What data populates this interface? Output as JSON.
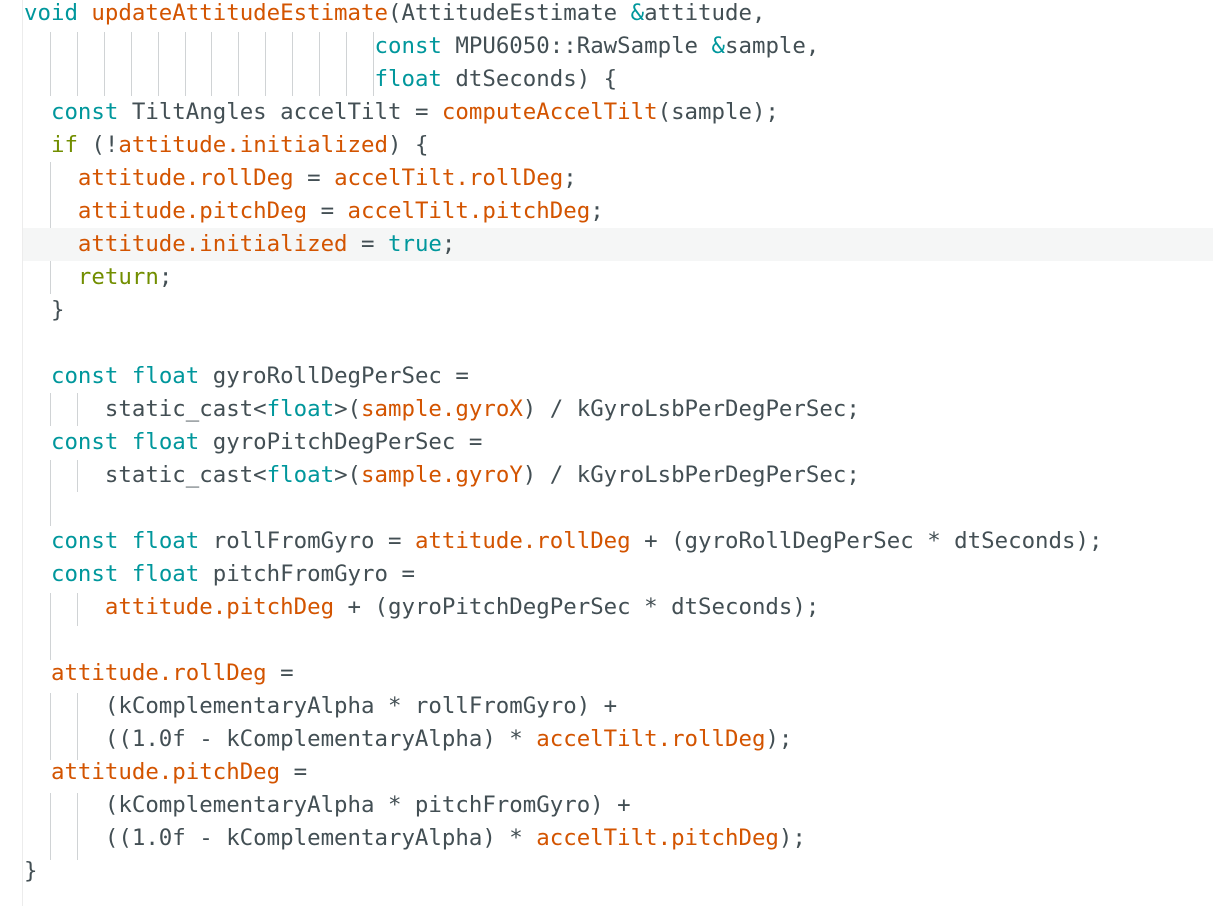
{
  "editor": {
    "language": "C++",
    "colors": {
      "background": "#ffffff",
      "current_line": "#f5f6f6",
      "keyword": "#00979c",
      "function_member": "#d35400",
      "control": "#728e00",
      "default_text": "#434f54",
      "indent_guide": "#d0d3d5"
    },
    "lines": [
      [
        [
          "kw",
          "void"
        ],
        [
          "id",
          " "
        ],
        [
          "fn",
          "updateAttitudeEstimate"
        ],
        [
          "id",
          "(AttitudeEstimate "
        ],
        [
          "kw",
          "&"
        ],
        [
          "id",
          "attitude,"
        ]
      ],
      [
        [
          "id",
          "                          "
        ],
        [
          "kw",
          "const"
        ],
        [
          "id",
          " MPU6050::RawSample "
        ],
        [
          "kw",
          "&"
        ],
        [
          "id",
          "sample,"
        ]
      ],
      [
        [
          "id",
          "                          "
        ],
        [
          "kw",
          "float"
        ],
        [
          "id",
          " dtSeconds) {"
        ]
      ],
      [
        [
          "id",
          "  "
        ],
        [
          "kw",
          "const"
        ],
        [
          "id",
          " TiltAngles accelTilt = "
        ],
        [
          "fn",
          "computeAccelTilt"
        ],
        [
          "id",
          "(sample);"
        ]
      ],
      [
        [
          "id",
          "  "
        ],
        [
          "ctl",
          "if"
        ],
        [
          "id",
          " (!"
        ],
        [
          "fn",
          "attitude.initialized"
        ],
        [
          "id",
          ") {"
        ]
      ],
      [
        [
          "id",
          "    "
        ],
        [
          "fn",
          "attitude.rollDeg"
        ],
        [
          "id",
          " = "
        ],
        [
          "fn",
          "accelTilt.rollDeg"
        ],
        [
          "id",
          ";"
        ]
      ],
      [
        [
          "id",
          "    "
        ],
        [
          "fn",
          "attitude.pitchDeg"
        ],
        [
          "id",
          " = "
        ],
        [
          "fn",
          "accelTilt.pitchDeg"
        ],
        [
          "id",
          ";"
        ]
      ],
      [
        [
          "id",
          "    "
        ],
        [
          "fn",
          "attitude.initialized"
        ],
        [
          "id",
          " = "
        ],
        [
          "kw",
          "true"
        ],
        [
          "id",
          ";"
        ]
      ],
      [
        [
          "id",
          "    "
        ],
        [
          "ctl",
          "return"
        ],
        [
          "id",
          ";"
        ]
      ],
      [
        [
          "id",
          "  }"
        ]
      ],
      [],
      [
        [
          "id",
          "  "
        ],
        [
          "kw",
          "const"
        ],
        [
          "id",
          " "
        ],
        [
          "kw",
          "float"
        ],
        [
          "id",
          " gyroRollDegPerSec ="
        ]
      ],
      [
        [
          "id",
          "      static_cast<"
        ],
        [
          "kw",
          "float"
        ],
        [
          "id",
          ">("
        ],
        [
          "fn",
          "sample.gyroX"
        ],
        [
          "id",
          ") / kGyroLsbPerDegPerSec;"
        ]
      ],
      [
        [
          "id",
          "  "
        ],
        [
          "kw",
          "const"
        ],
        [
          "id",
          " "
        ],
        [
          "kw",
          "float"
        ],
        [
          "id",
          " gyroPitchDegPerSec ="
        ]
      ],
      [
        [
          "id",
          "      static_cast<"
        ],
        [
          "kw",
          "float"
        ],
        [
          "id",
          ">("
        ],
        [
          "fn",
          "sample.gyroY"
        ],
        [
          "id",
          ") / kGyroLsbPerDegPerSec;"
        ]
      ],
      [],
      [
        [
          "id",
          "  "
        ],
        [
          "kw",
          "const"
        ],
        [
          "id",
          " "
        ],
        [
          "kw",
          "float"
        ],
        [
          "id",
          " rollFromGyro = "
        ],
        [
          "fn",
          "attitude.rollDeg"
        ],
        [
          "id",
          " + (gyroRollDegPerSec * dtSeconds);"
        ]
      ],
      [
        [
          "id",
          "  "
        ],
        [
          "kw",
          "const"
        ],
        [
          "id",
          " "
        ],
        [
          "kw",
          "float"
        ],
        [
          "id",
          " pitchFromGyro ="
        ]
      ],
      [
        [
          "id",
          "      "
        ],
        [
          "fn",
          "attitude.pitchDeg"
        ],
        [
          "id",
          " + (gyroPitchDegPerSec * dtSeconds);"
        ]
      ],
      [],
      [
        [
          "id",
          "  "
        ],
        [
          "fn",
          "attitude.rollDeg"
        ],
        [
          "id",
          " ="
        ]
      ],
      [
        [
          "id",
          "      (kComplementaryAlpha * rollFromGyro) +"
        ]
      ],
      [
        [
          "id",
          "      (("
        ],
        [
          "num",
          "1.0f"
        ],
        [
          "id",
          " - kComplementaryAlpha) * "
        ],
        [
          "fn",
          "accelTilt.rollDeg"
        ],
        [
          "id",
          ");"
        ]
      ],
      [
        [
          "id",
          "  "
        ],
        [
          "fn",
          "attitude.pitchDeg"
        ],
        [
          "id",
          " ="
        ]
      ],
      [
        [
          "id",
          "      (kComplementaryAlpha * pitchFromGyro) +"
        ]
      ],
      [
        [
          "id",
          "      (("
        ],
        [
          "num",
          "1.0f"
        ],
        [
          "id",
          " - kComplementaryAlpha) * "
        ],
        [
          "fn",
          "accelTilt.pitchDeg"
        ],
        [
          "id",
          ");"
        ]
      ],
      [
        [
          "id",
          "}"
        ]
      ]
    ]
  }
}
